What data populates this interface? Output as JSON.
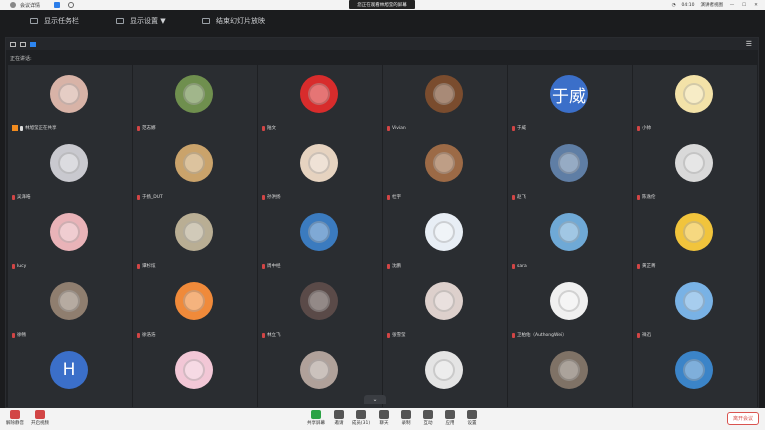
{
  "topbar": {
    "meeting_title": "会议详情",
    "share_banner": "您正在观看林旭莹的屏幕",
    "time": "04:10",
    "view_mode": "演讲者视图"
  },
  "toolbar2": {
    "items": [
      {
        "label": "显示任务栏",
        "icon": "taskbar-icon"
      },
      {
        "label": "显示设置 ▼",
        "icon": "settings-icon"
      },
      {
        "label": "结束幻灯片放映",
        "icon": "slideshow-icon"
      }
    ]
  },
  "panel": {
    "speaking_label": "正在讲话:"
  },
  "participants": [
    {
      "name": "林旭莹正在共享",
      "avatar": "cat-cartoon",
      "bg": "#d8b3a7",
      "sharing": true
    },
    {
      "name": "范志娜",
      "avatar": "dog-grass",
      "bg": "#6f8f4e"
    },
    {
      "name": "陆文",
      "avatar": "red-logo",
      "bg": "#d82c2c"
    },
    {
      "name": "Vivian",
      "avatar": "brown-animal",
      "bg": "#7a4c2e"
    },
    {
      "name": "于威",
      "avatar": "letter",
      "letter": "于威",
      "bg": "#3b6fc9"
    },
    {
      "name": "小帅",
      "avatar": "pooh-bear",
      "bg": "#f3e2a8"
    },
    {
      "name": "吴泽皓",
      "avatar": "white-cat",
      "bg": "#c9c9cf"
    },
    {
      "name": "于扬_DUT",
      "avatar": "dog-frame",
      "bg": "#caa36b"
    },
    {
      "name": "孙洪扬",
      "avatar": "red-hair-girl",
      "bg": "#e6d3c0"
    },
    {
      "name": "杜宇",
      "avatar": "food",
      "bg": "#9c6a46"
    },
    {
      "name": "赵飞",
      "avatar": "totoro",
      "bg": "#5f7ea5"
    },
    {
      "name": "陈逸伦",
      "avatar": "man-glasses",
      "bg": "#d9d9d9"
    },
    {
      "name": "lucy",
      "avatar": "girl-glasses",
      "bg": "#e9b3b8"
    },
    {
      "name": "谭杉炫",
      "avatar": "statue",
      "bg": "#b9ae94"
    },
    {
      "name": "周中经",
      "avatar": "sky-tower",
      "bg": "#3b7bbf"
    },
    {
      "name": "沈鹏",
      "avatar": "drawing",
      "bg": "#e8eef5"
    },
    {
      "name": "sara",
      "avatar": "lake",
      "bg": "#6fa9d6"
    },
    {
      "name": "黄芷菁",
      "avatar": "yellow-logo",
      "bg": "#f1c43c"
    },
    {
      "name": "徐畅",
      "avatar": "sketch-girl",
      "bg": "#8f7e6f"
    },
    {
      "name": "徐浩浩",
      "avatar": "cartoon-tiger",
      "bg": "#f08a3a"
    },
    {
      "name": "林立飞",
      "avatar": "dark-photo",
      "bg": "#5a4a48"
    },
    {
      "name": "张雪莹",
      "avatar": "white-cats",
      "bg": "#ddd0cc"
    },
    {
      "name": "卫柏佑（AuthongWei）",
      "avatar": "emoji-kiss",
      "bg": "#f0f0f0"
    },
    {
      "name": "祥迅",
      "avatar": "pixel-girl",
      "bg": "#79b2e5"
    },
    {
      "name": "",
      "avatar": "letter",
      "letter": "H",
      "bg": "#3b6fc9"
    },
    {
      "name": "",
      "avatar": "white-dog",
      "bg": "#f2c7d6"
    },
    {
      "name": "",
      "avatar": "cats-photo",
      "bg": "#b0a19a"
    },
    {
      "name": "",
      "avatar": "totoro-bw",
      "bg": "#e4e4e4"
    },
    {
      "name": "",
      "avatar": "sunset",
      "bg": "#7f7266"
    },
    {
      "name": "",
      "avatar": "dolphin",
      "bg": "#3b84c8"
    }
  ],
  "bottombar": {
    "items": [
      {
        "label": "解除静音",
        "icon": "mic-icon",
        "color": "#d24545"
      },
      {
        "label": "开启视频",
        "icon": "video-icon",
        "color": "#d24545"
      },
      {
        "label": "共享屏幕",
        "icon": "share-icon",
        "color": "#2ba245"
      },
      {
        "label": "邀请",
        "icon": "invite-icon",
        "color": "#555"
      },
      {
        "label": "成员(31)",
        "icon": "members-icon",
        "color": "#555"
      },
      {
        "label": "聊天",
        "icon": "chat-icon",
        "color": "#555"
      },
      {
        "label": "录制",
        "icon": "record-icon",
        "color": "#555"
      },
      {
        "label": "互动",
        "icon": "interact-icon",
        "color": "#555"
      },
      {
        "label": "应用",
        "icon": "apps-icon",
        "color": "#555"
      },
      {
        "label": "设置",
        "icon": "gear-icon",
        "color": "#555"
      }
    ],
    "end_label": "离开会议"
  }
}
